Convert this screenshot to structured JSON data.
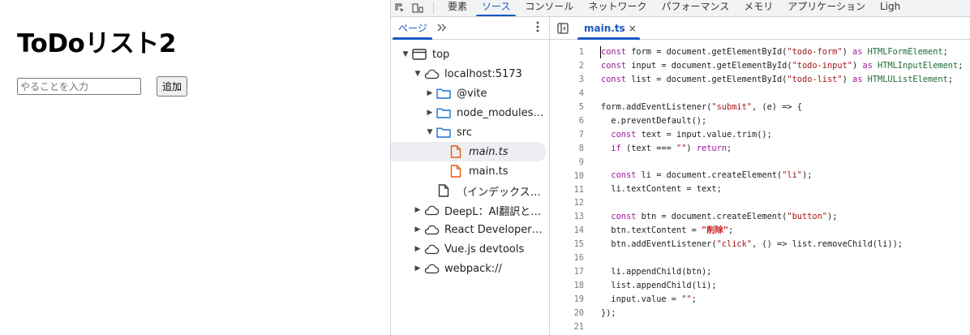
{
  "app": {
    "title": "ToDoリスト2",
    "input_placeholder": "やることを入力",
    "add_button": "追加"
  },
  "devtools": {
    "main_tabs": [
      "要素",
      "ソース",
      "コンソール",
      "ネットワーク",
      "パフォーマンス",
      "メモリ",
      "アプリケーション",
      "Ligh"
    ],
    "active_main_tab": "ソース",
    "navigator": {
      "tab_label": "ページ",
      "more_icon": "chevron-double-right-icon",
      "tree": [
        {
          "label": "top",
          "icon": "frame-icon",
          "arrow": "▼",
          "level": 0
        },
        {
          "label": "localhost:5173",
          "icon": "cloud-icon",
          "arrow": "▼",
          "level": 1
        },
        {
          "label": "@vite",
          "icon": "folder-icon",
          "arrow": "▶",
          "level": 2
        },
        {
          "label": "node_modules…",
          "icon": "folder-icon",
          "arrow": "▶",
          "level": 2
        },
        {
          "label": "src",
          "icon": "folder-icon",
          "arrow": "▼",
          "level": 2
        },
        {
          "label": "main.ts",
          "icon": "ts-file-icon",
          "arrow": "",
          "level": 3,
          "selected": true,
          "italic": true
        },
        {
          "label": "main.ts",
          "icon": "ts-file-icon",
          "arrow": "",
          "level": 3
        },
        {
          "label": "（インデックス…",
          "icon": "document-icon",
          "arrow": "",
          "level": 2
        },
        {
          "label": "DeepL：AI翻訳と…",
          "icon": "cloud-icon",
          "arrow": "▶",
          "level": 1
        },
        {
          "label": "React Developer…",
          "icon": "cloud-icon",
          "arrow": "▶",
          "level": 1
        },
        {
          "label": "Vue.js devtools",
          "icon": "cloud-icon",
          "arrow": "▶",
          "level": 1
        },
        {
          "label": "webpack://",
          "icon": "cloud-icon",
          "arrow": "▶",
          "level": 1
        }
      ]
    },
    "editor": {
      "tab_label": "main.ts",
      "close_label": "×",
      "code_lines": [
        [
          [
            "kw",
            "const"
          ],
          [
            "p",
            " form = document.getElementById("
          ],
          [
            "str",
            "\"todo-form\""
          ],
          [
            "p",
            ") "
          ],
          [
            "kw",
            "as"
          ],
          [
            "p",
            " "
          ],
          [
            "type",
            "HTMLFormElement"
          ],
          [
            "p",
            ";"
          ]
        ],
        [
          [
            "kw",
            "const"
          ],
          [
            "p",
            " input = document.getElementById("
          ],
          [
            "str",
            "\"todo-input\""
          ],
          [
            "p",
            ") "
          ],
          [
            "kw",
            "as"
          ],
          [
            "p",
            " "
          ],
          [
            "type",
            "HTMLInputElement"
          ],
          [
            "p",
            ";"
          ]
        ],
        [
          [
            "kw",
            "const"
          ],
          [
            "p",
            " list = document.getElementById("
          ],
          [
            "str",
            "\"todo-list\""
          ],
          [
            "p",
            ") "
          ],
          [
            "kw",
            "as"
          ],
          [
            "p",
            " "
          ],
          [
            "type",
            "HTMLUListElement"
          ],
          [
            "p",
            ";"
          ]
        ],
        [],
        [
          [
            "p",
            "form.addEventListener("
          ],
          [
            "str",
            "\"submit\""
          ],
          [
            "p",
            ", (e) => {"
          ]
        ],
        [
          [
            "p",
            "  e.preventDefault();"
          ]
        ],
        [
          [
            "p",
            "  "
          ],
          [
            "kw",
            "const"
          ],
          [
            "p",
            " text = input.value.trim();"
          ]
        ],
        [
          [
            "p",
            "  "
          ],
          [
            "kw",
            "if"
          ],
          [
            "p",
            " (text === "
          ],
          [
            "str",
            "\"\""
          ],
          [
            "p",
            ") "
          ],
          [
            "kw",
            "return"
          ],
          [
            "p",
            ";"
          ]
        ],
        [],
        [
          [
            "p",
            "  "
          ],
          [
            "kw",
            "const"
          ],
          [
            "p",
            " li = document.createElement("
          ],
          [
            "str",
            "\"li\""
          ],
          [
            "p",
            ");"
          ]
        ],
        [
          [
            "p",
            "  li.textContent = text;"
          ]
        ],
        [],
        [
          [
            "p",
            "  "
          ],
          [
            "kw",
            "const"
          ],
          [
            "p",
            " btn = document.createElement("
          ],
          [
            "str",
            "\"button\""
          ],
          [
            "p",
            ");"
          ]
        ],
        [
          [
            "p",
            "  btn.textContent = "
          ],
          [
            "strjp",
            "\"削除\""
          ],
          [
            "p",
            ";"
          ]
        ],
        [
          [
            "p",
            "  btn.addEventListener("
          ],
          [
            "str",
            "\"click\""
          ],
          [
            "p",
            ", () => list.removeChild(li));"
          ]
        ],
        [],
        [
          [
            "p",
            "  li.appendChild(btn);"
          ]
        ],
        [
          [
            "p",
            "  list.appendChild(li);"
          ]
        ],
        [
          [
            "p",
            "  input.value = "
          ],
          [
            "str",
            "\"\""
          ],
          [
            "p",
            ";"
          ]
        ],
        [
          [
            "p",
            "});"
          ]
        ],
        []
      ]
    }
  }
}
